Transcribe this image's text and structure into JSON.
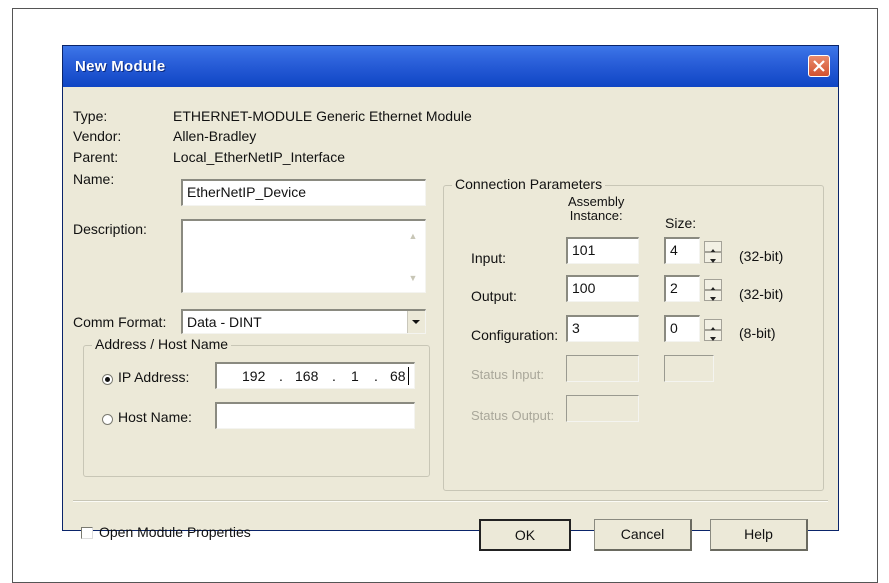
{
  "dialog": {
    "title": "New Module"
  },
  "info": {
    "type_label": "Type:",
    "type_value": "ETHERNET-MODULE Generic Ethernet Module",
    "vendor_label": "Vendor:",
    "vendor_value": "Allen-Bradley",
    "parent_label": "Parent:",
    "parent_value": "Local_EtherNetIP_Interface",
    "name_label": "Name:",
    "name_value": "EtherNetIP_Device",
    "description_label": "Description:",
    "description_value": ""
  },
  "comm_format": {
    "label": "Comm Format:",
    "value": "Data - DINT"
  },
  "address": {
    "group_title": "Address / Host Name",
    "ip_label": "IP Address:",
    "ip_octets": [
      "192",
      "168",
      "1",
      "68"
    ],
    "ip_dots": [
      ".",
      ".",
      "."
    ],
    "ip_selected": true,
    "host_label": "Host Name:",
    "host_value": ""
  },
  "connection": {
    "group_title": "Connection Parameters",
    "assembly_header": [
      "Assembly",
      "Instance:"
    ],
    "size_header": "Size:",
    "rows": [
      {
        "label": "Input:",
        "instance": "101",
        "size": "4",
        "unit": "(32-bit)"
      },
      {
        "label": "Output:",
        "instance": "100",
        "size": "2",
        "unit": "(32-bit)"
      },
      {
        "label": "Configuration:",
        "instance": "3",
        "size": "0",
        "unit": "(8-bit)"
      }
    ],
    "status_input_label": "Status Input:",
    "status_output_label": "Status Output:"
  },
  "options": {
    "open_props_label": "Open Module Properties",
    "open_props_checked": false
  },
  "buttons": {
    "ok": "OK",
    "cancel": "Cancel",
    "help": "Help"
  },
  "icons": {
    "close": "close-icon",
    "dropdown": "chevron-down-icon",
    "spin_up": "spin-up-icon",
    "spin_down": "spin-down-icon"
  },
  "colors": {
    "titlebar": "#2a5fd9",
    "dialog_bg": "#ece9d8",
    "close_button": "#d2522f"
  }
}
